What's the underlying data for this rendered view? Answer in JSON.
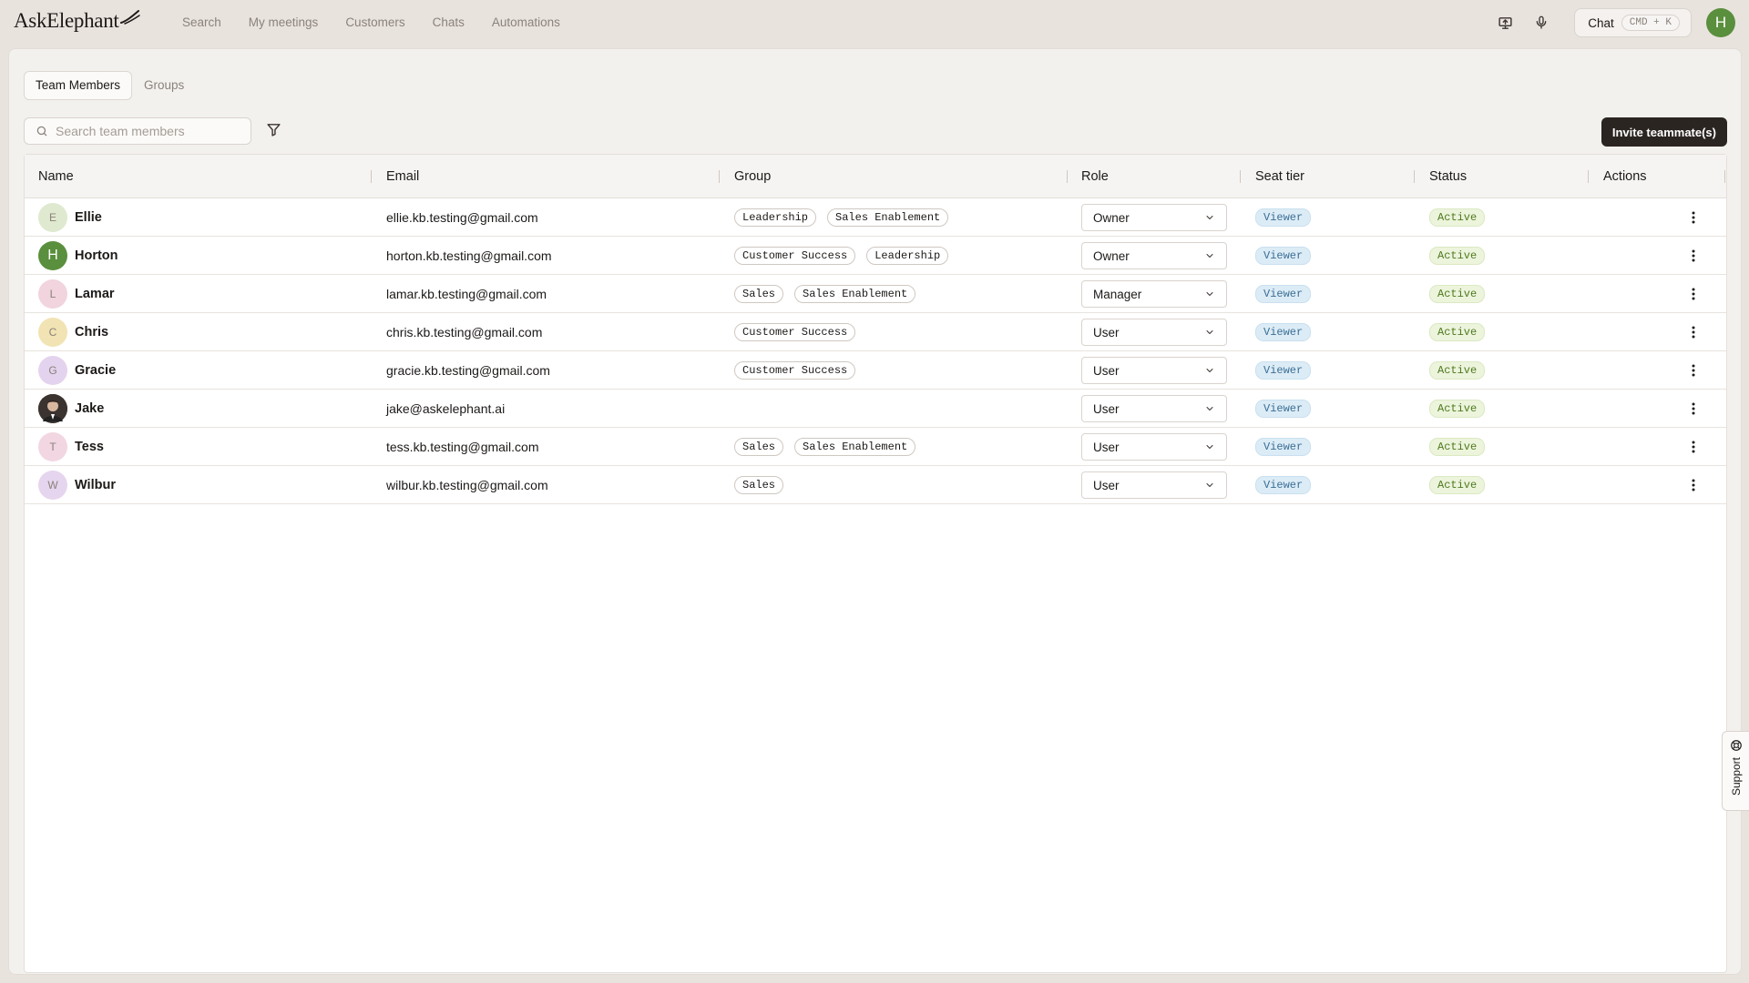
{
  "app": {
    "logo_text": "AskElephant",
    "nav": [
      "Search",
      "My meetings",
      "Customers",
      "Chats",
      "Automations"
    ],
    "chat_label": "Chat",
    "chat_shortcut": "CMD + K",
    "user_initial": "H"
  },
  "tabs": [
    {
      "label": "Team Members",
      "active": true
    },
    {
      "label": "Groups",
      "active": false
    }
  ],
  "search": {
    "placeholder": "Search team members"
  },
  "invite_label": "Invite teammate(s)",
  "table": {
    "columns": [
      "Name",
      "Email",
      "Group",
      "Role",
      "Seat tier",
      "Status",
      "Actions"
    ],
    "rows": [
      {
        "initial": "E",
        "avatar_bg": "#dfe9cf",
        "name": "Ellie",
        "email": "ellie.kb.testing@gmail.com",
        "groups": [
          "Leadership",
          "Sales Enablement"
        ],
        "role": "Owner",
        "seat": "Viewer",
        "status": "Active"
      },
      {
        "initial": "H",
        "avatar_bg": "#5a8f3d",
        "avatar_fg": "#ffffff",
        "name": "Horton",
        "email": "horton.kb.testing@gmail.com",
        "groups": [
          "Customer Success",
          "Leadership"
        ],
        "role": "Owner",
        "seat": "Viewer",
        "status": "Active"
      },
      {
        "initial": "L",
        "avatar_bg": "#f1d4dd",
        "name": "Lamar",
        "email": "lamar.kb.testing@gmail.com",
        "groups": [
          "Sales",
          "Sales Enablement"
        ],
        "role": "Manager",
        "seat": "Viewer",
        "status": "Active"
      },
      {
        "initial": "C",
        "avatar_bg": "#f1e3b3",
        "name": "Chris",
        "email": "chris.kb.testing@gmail.com",
        "groups": [
          "Customer Success"
        ],
        "role": "User",
        "seat": "Viewer",
        "status": "Active"
      },
      {
        "initial": "G",
        "avatar_bg": "#e4d3ee",
        "name": "Gracie",
        "email": "gracie.kb.testing@gmail.com",
        "groups": [
          "Customer Success"
        ],
        "role": "User",
        "seat": "Viewer",
        "status": "Active"
      },
      {
        "initial": "",
        "avatar_bg": "#3a3330",
        "photo": true,
        "name": "Jake",
        "email": "jake@askelephant.ai",
        "groups": [],
        "role": "User",
        "seat": "Viewer",
        "status": "Active"
      },
      {
        "initial": "T",
        "avatar_bg": "#f2d6e2",
        "name": "Tess",
        "email": "tess.kb.testing@gmail.com",
        "groups": [
          "Sales",
          "Sales Enablement"
        ],
        "role": "User",
        "seat": "Viewer",
        "status": "Active"
      },
      {
        "initial": "W",
        "avatar_bg": "#e6d5ee",
        "name": "Wilbur",
        "email": "wilbur.kb.testing@gmail.com",
        "groups": [
          "Sales"
        ],
        "role": "User",
        "seat": "Viewer",
        "status": "Active"
      }
    ]
  },
  "support_label": "Support",
  "icons": {
    "screen": "present-screen-icon",
    "mic": "microphone-icon",
    "search": "search-icon",
    "filter": "filter-icon",
    "chevron": "chevron-down-icon",
    "more": "more-vertical-icon",
    "support": "lifebuoy-icon"
  }
}
